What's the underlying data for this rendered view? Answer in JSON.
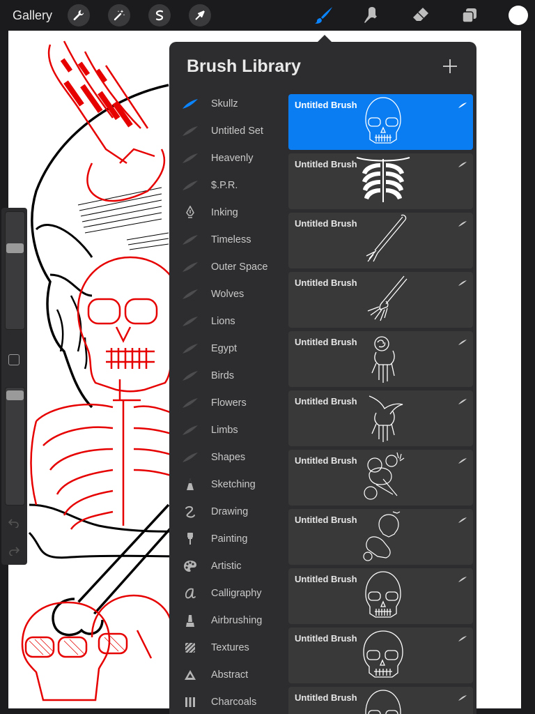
{
  "topbar": {
    "gallery_label": "Gallery",
    "tools": [
      "wrench-icon",
      "magic-wand-icon",
      "selection-s-icon",
      "transform-arrow-icon"
    ],
    "active_tool": "brush",
    "active_color": "#0a7df2",
    "current_color": "#ffffff"
  },
  "brush_library": {
    "title": "Brush Library",
    "sets": [
      {
        "label": "Skullz",
        "icon": "feather-icon",
        "active": true
      },
      {
        "label": "Untitled Set",
        "icon": "stroke-icon"
      },
      {
        "label": "Heavenly",
        "icon": "stroke-icon"
      },
      {
        "label": "$.P.R.",
        "icon": "stroke-icon"
      },
      {
        "label": "Inking",
        "icon": "pen-nib-icon"
      },
      {
        "label": "Timeless",
        "icon": "stroke-icon"
      },
      {
        "label": "Outer Space",
        "icon": "stroke-icon"
      },
      {
        "label": "Wolves",
        "icon": "stroke-icon"
      },
      {
        "label": "Lions",
        "icon": "stroke-icon"
      },
      {
        "label": "Egypt",
        "icon": "stroke-icon"
      },
      {
        "label": "Birds",
        "icon": "stroke-icon"
      },
      {
        "label": "Flowers",
        "icon": "stroke-icon"
      },
      {
        "label": "Limbs",
        "icon": "stroke-icon"
      },
      {
        "label": "Shapes",
        "icon": "stroke-icon"
      },
      {
        "label": "Sketching",
        "icon": "pencil-tip-icon"
      },
      {
        "label": "Drawing",
        "icon": "squiggle-icon"
      },
      {
        "label": "Painting",
        "icon": "paint-brush-icon"
      },
      {
        "label": "Artistic",
        "icon": "palette-icon"
      },
      {
        "label": "Calligraphy",
        "icon": "calligraphy-a-icon"
      },
      {
        "label": "Airbrushing",
        "icon": "airbrush-icon"
      },
      {
        "label": "Textures",
        "icon": "texture-icon"
      },
      {
        "label": "Abstract",
        "icon": "triangle-icon"
      },
      {
        "label": "Charcoals",
        "icon": "charcoal-icon"
      }
    ],
    "brushes": [
      {
        "name": "Untitled Brush",
        "preview": "skull",
        "selected": true
      },
      {
        "name": "Untitled Brush",
        "preview": "ribcage"
      },
      {
        "name": "Untitled Brush",
        "preview": "arm-bone"
      },
      {
        "name": "Untitled Brush",
        "preview": "arm-hand"
      },
      {
        "name": "Untitled Brush",
        "preview": "hand-rose"
      },
      {
        "name": "Untitled Brush",
        "preview": "hand-bird"
      },
      {
        "name": "Untitled Brush",
        "preview": "skull-roses"
      },
      {
        "name": "Untitled Brush",
        "preview": "skull-hand"
      },
      {
        "name": "Untitled Brush",
        "preview": "skull"
      },
      {
        "name": "Untitled Brush",
        "preview": "skull-side"
      },
      {
        "name": "Untitled Brush",
        "preview": "skull"
      }
    ]
  }
}
